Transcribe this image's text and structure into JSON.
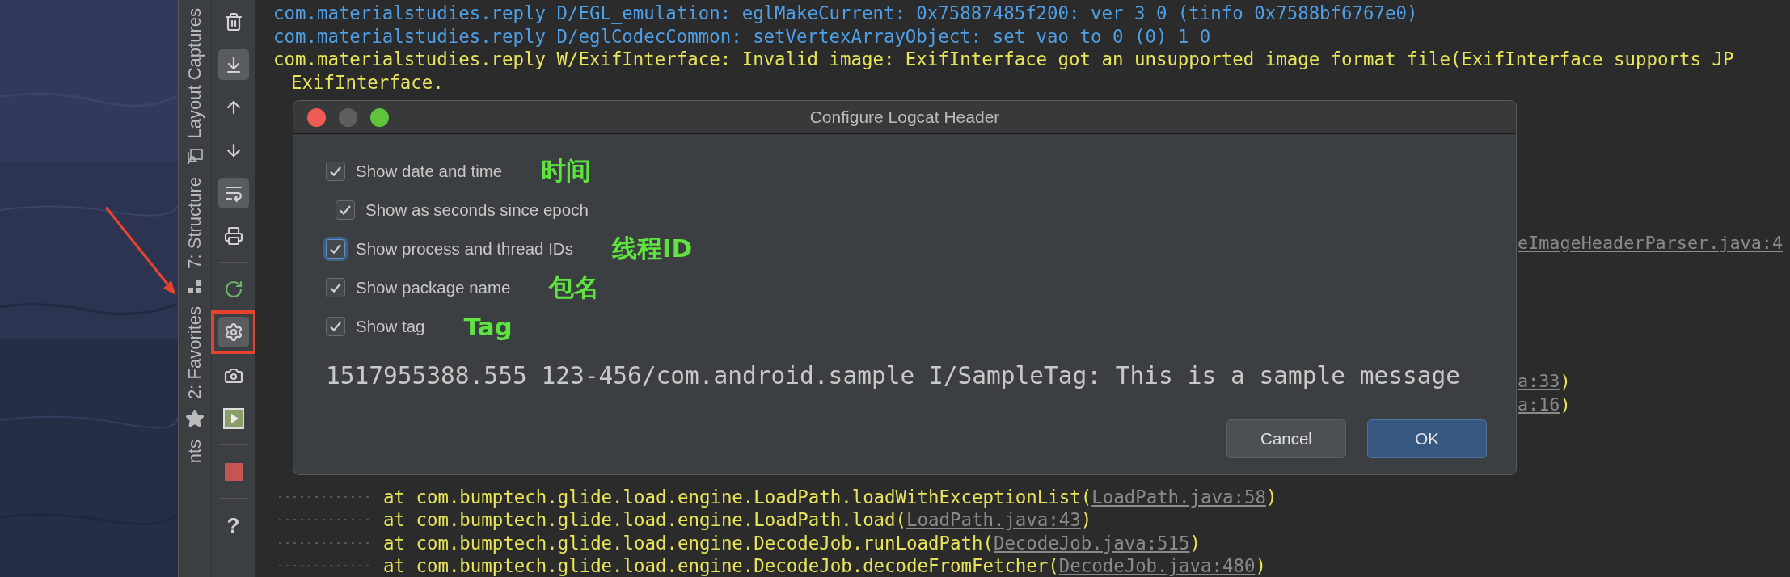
{
  "tool_strip": {
    "tabs": [
      {
        "label": "Layout Captures",
        "kind": "captures"
      },
      {
        "label": "7: Structure",
        "kind": "structure"
      },
      {
        "label": "2: Favorites",
        "kind": "star"
      },
      {
        "label": "nts",
        "kind": "plain"
      }
    ]
  },
  "toolbar": {
    "items": [
      {
        "kind": "trash",
        "on": false
      },
      {
        "kind": "scroll-end",
        "on": true
      },
      {
        "kind": "up",
        "on": false
      },
      {
        "kind": "down",
        "on": false
      },
      {
        "kind": "wrap",
        "on": true
      },
      {
        "kind": "print",
        "on": false
      },
      {
        "kind": "separator"
      },
      {
        "kind": "restart",
        "on": false
      },
      {
        "kind": "settings",
        "on": true,
        "highlighted": true
      },
      {
        "kind": "camera",
        "on": false
      },
      {
        "kind": "record",
        "on": false
      },
      {
        "kind": "separator"
      },
      {
        "kind": "stop",
        "on": false
      },
      {
        "kind": "separator"
      },
      {
        "kind": "help",
        "on": false,
        "glyph": "?"
      }
    ]
  },
  "log": {
    "top_lines": [
      {
        "kind": "debug",
        "text": "com.materialstudies.reply D/EGL_emulation: eglMakeCurrent: 0x75887485f200: ver 3 0 (tinfo 0x7588bf6767e0)"
      },
      {
        "kind": "debug",
        "text": "com.materialstudies.reply D/eglCodecCommon: setVertexArrayObject: set vao to 0 (0) 1 0"
      },
      {
        "kind": "warning",
        "text": "com.materialstudies.reply W/ExifInterface: Invalid image: ExifInterface got an unsupported image format file(ExifInterface supports JP"
      },
      {
        "kind": "continuation",
        "text": "ExifInterface."
      }
    ],
    "fragments": [
      {
        "link": "eImageHeaderParser.java:4"
      },
      {
        "link": "a:33",
        "tail": ")"
      },
      {
        "link": "a:16",
        "tail": ")"
      }
    ],
    "bottom_lines": [
      {
        "text": "at com.bumptech.glide.load.engine.LoadPath.loadWithExceptionList(",
        "link": "LoadPath.java:58",
        "tail": ")"
      },
      {
        "text": "at com.bumptech.glide.load.engine.LoadPath.load(",
        "link": "LoadPath.java:43",
        "tail": ")"
      },
      {
        "text": "at com.bumptech.glide.load.engine.DecodeJob.runLoadPath(",
        "link": "DecodeJob.java:515",
        "tail": ")"
      },
      {
        "text": "at com.bumptech.glide.load.engine.DecodeJob.decodeFromFetcher(",
        "link": "DecodeJob.java:480",
        "tail": ")"
      }
    ]
  },
  "dialog": {
    "title": "Configure Logcat Header",
    "options": [
      {
        "label": "Show date and time",
        "checked": true,
        "focused": false,
        "note": "时间",
        "children": [
          {
            "label": "Show as seconds since epoch",
            "checked": true,
            "focused": false
          }
        ]
      },
      {
        "label": "Show process and thread IDs",
        "checked": true,
        "focused": true,
        "note": "线程ID"
      },
      {
        "label": "Show package name",
        "checked": true,
        "focused": false,
        "note": "包名"
      },
      {
        "label": "Show tag",
        "checked": true,
        "focused": false,
        "note": "Tag"
      }
    ],
    "sample": "1517955388.555 123-456/com.android.sample I/SampleTag: This is a sample message",
    "buttons": [
      {
        "label": "Cancel",
        "kind": "secondary"
      },
      {
        "label": "OK",
        "kind": "primary"
      }
    ]
  }
}
